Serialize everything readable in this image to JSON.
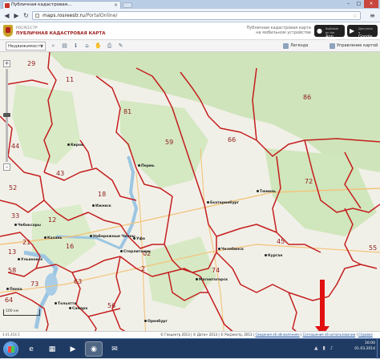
{
  "browser": {
    "tab_title": "Публичная кадастровая...",
    "url_host": "maps.rosreestr.ru",
    "url_path": "/PortalOnline/",
    "back_icon": "back-arrow-icon",
    "forward_icon": "forward-arrow-icon",
    "reload_icon": "reload-icon"
  },
  "site": {
    "subtitle": "РОСРЕЕСТР",
    "title": "ПУБЛИЧНАЯ КАДАСТРОВАЯ КАРТА",
    "promo": "Публичная кадастровая карта на мобильном устройстве",
    "appstore_small": "Available on the",
    "appstore": "App Store",
    "googleplay_small": "Доступно в",
    "googleplay": "Google play"
  },
  "toolbar": {
    "select_value": "Недвижимость",
    "legend": "Легенда",
    "manage_maps": "Управление картой"
  },
  "map": {
    "regions": [
      {
        "n": "29"
      },
      {
        "n": "11"
      },
      {
        "n": "86"
      },
      {
        "n": "81"
      },
      {
        "n": "59"
      },
      {
        "n": "66"
      },
      {
        "n": "44"
      },
      {
        "n": "18"
      },
      {
        "n": "02"
      },
      {
        "n": "52"
      },
      {
        "n": "43"
      },
      {
        "n": "21"
      },
      {
        "n": "12"
      },
      {
        "n": "16"
      },
      {
        "n": "74"
      },
      {
        "n": "45"
      },
      {
        "n": "72"
      },
      {
        "n": "55"
      },
      {
        "n": "73"
      },
      {
        "n": "63"
      },
      {
        "n": "56"
      },
      {
        "n": "58"
      },
      {
        "n": "13"
      },
      {
        "n": "33"
      },
      {
        "n": "2"
      },
      {
        "n": "64"
      }
    ],
    "cities": [
      {
        "name": "Пермь"
      },
      {
        "name": "Ижевск"
      },
      {
        "name": "Екатеринбург"
      },
      {
        "name": "Тюмень"
      },
      {
        "name": "Набережные Челны"
      },
      {
        "name": "Казань"
      },
      {
        "name": "Уфа"
      },
      {
        "name": "Челябинск"
      },
      {
        "name": "Тольятти"
      },
      {
        "name": "Самара"
      },
      {
        "name": "Киров"
      },
      {
        "name": "Курган"
      },
      {
        "name": "Чебоксары"
      },
      {
        "name": "Ульяновск"
      },
      {
        "name": "Пенза"
      },
      {
        "name": "Оренбург"
      },
      {
        "name": "Магнитогорск"
      },
      {
        "name": "Стерлитамак"
      }
    ],
    "scale_label": "100 км"
  },
  "footer": {
    "version": "4.01.454.5",
    "copyright": "© Геоцентр 2013 | © Дата+ 2013 | © Росреестр, 2013 |",
    "link_data": "Сведения об обновлениях",
    "link_terms": "Соглашение об использовании",
    "link_help": "Справка"
  },
  "taskbar": {
    "time": "16:00",
    "date": "01.03.2014"
  },
  "colors": {
    "boundary": "#c41e1e",
    "forest": "#cde5b8",
    "water": "#a9cde6",
    "annotation": "#e01010"
  }
}
